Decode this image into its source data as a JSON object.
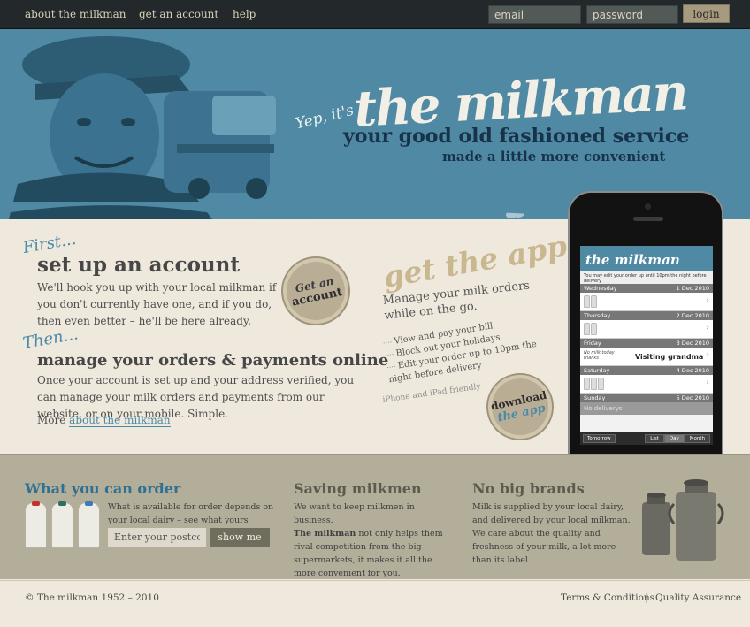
{
  "nav": {
    "items": [
      "about the milkman",
      "get an account",
      "help"
    ],
    "email_placeholder": "email",
    "password_placeholder": "password",
    "login_label": "login"
  },
  "hero": {
    "lead": "Yep, it's",
    "brand": "the milkman",
    "tagline": "your good old fashioned service",
    "subtagline": "made a little more convenient"
  },
  "steps": [
    {
      "lead": "First...",
      "title": "set up an account",
      "body": "We'll hook you up with your local milkman if you don't currently have one, and if you do, then even better – he'll be here already."
    },
    {
      "lead": "Then...",
      "title": "manage your orders & payments online",
      "body": "Once your account is set up and your address verified, you can manage your milk orders and payments from our website, or on your mobile. Simple."
    }
  ],
  "more": {
    "prefix": "More ",
    "link": "about the milkman"
  },
  "badge_account": {
    "line1": "Get an",
    "line2": "account"
  },
  "badge_app": {
    "line1": "download",
    "line2": "the app"
  },
  "app": {
    "heading": "get the app",
    "intro": "Manage your milk orders while on the go.",
    "features": [
      "View and pay your bill",
      "Block out your holidays",
      "Edit your order up to 10pm the night before delivery"
    ],
    "note": "iPhone and iPad friendly"
  },
  "phone_screen": {
    "title": "the milkman",
    "info": "You may edit your order up until 10pm the night before delivery",
    "days": [
      {
        "day": "Wednesday",
        "date": "1 Dec 2010",
        "bottles": 2,
        "note": ""
      },
      {
        "day": "Thursday",
        "date": "2 Dec 2010",
        "bottles": 2,
        "note": ""
      },
      {
        "day": "Friday",
        "date": "3 Dec 2010",
        "bottles": 0,
        "note": "Visiting grandma",
        "small": "No milk today thanks"
      },
      {
        "day": "Saturday",
        "date": "4 Dec 2010",
        "bottles": 3,
        "note": ""
      },
      {
        "day": "Sunday",
        "date": "5 Dec 2010",
        "bottles": 0,
        "note": ""
      }
    ],
    "no_deliveries": "No deliverys",
    "tomorrow_btn": "Tomorrow",
    "segments": [
      "List",
      "Day",
      "Month"
    ]
  },
  "order": {
    "title": "What you can order",
    "body": "What is available for order depends on your local dairy – see what yours offers:",
    "postcode_placeholder": "Enter your postcode",
    "showme_label": "show me",
    "cap_colors": [
      "#c9302c",
      "#2f6f5e",
      "#3e79b8"
    ]
  },
  "saving": {
    "title": "Saving milkmen",
    "body1": "We want to keep milkmen in business.",
    "bold": "The milkman",
    "body2": " not only helps them rival competition from the big supermarkets, it makes it all the more convenient for you."
  },
  "brands": {
    "title": "No big brands",
    "body": "Milk is supplied by your local dairy, and delivered by your local milkman. We care about the quality and freshness of your milk, a lot more than its label."
  },
  "footer": {
    "copyright": "© The milkman 1952 – 2010",
    "terms": "Terms & Conditions",
    "separator": "|",
    "quality": "Quality Assurance"
  },
  "colors": {
    "hero_blue": "#4f89a3",
    "accent_blue": "#4a8aa8",
    "navy": "#18324a",
    "tan": "#c8b78f"
  }
}
